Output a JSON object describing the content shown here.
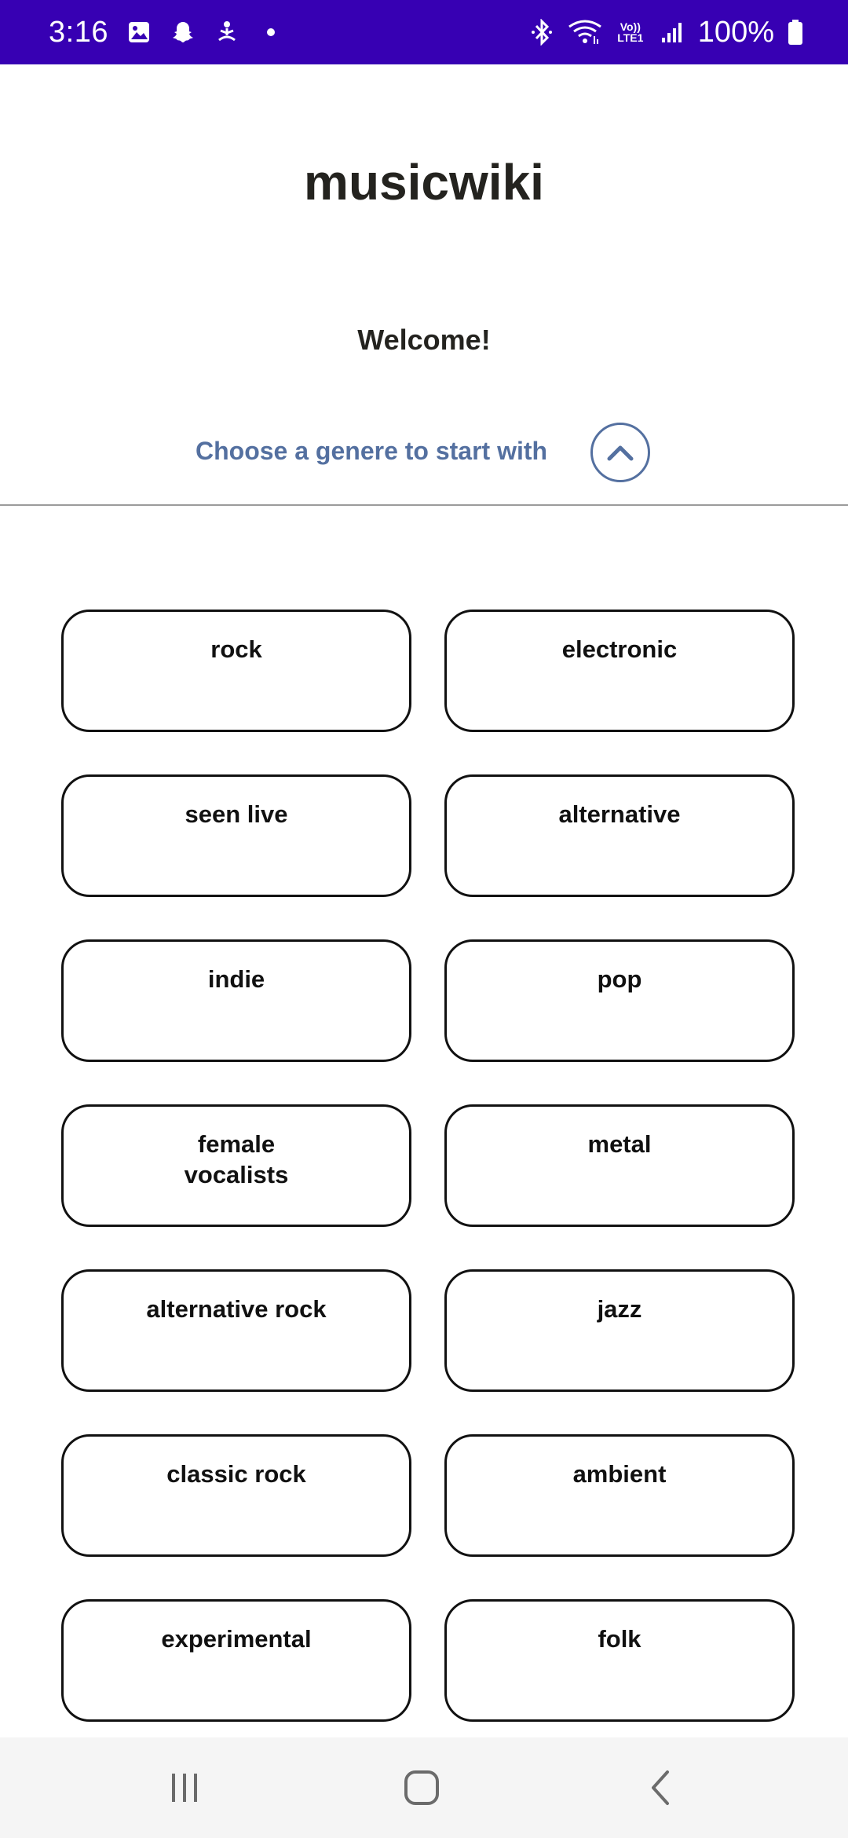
{
  "status_bar": {
    "time": "3:16",
    "battery": "100%",
    "network_label_top": "Vo))",
    "network_label_bottom": "LTE1",
    "icons": [
      "gallery-icon",
      "snapchat-icon",
      "yoga-icon",
      "dot-icon",
      "bluetooth-icon",
      "wifi-icon",
      "signal-icon",
      "battery-icon"
    ]
  },
  "app": {
    "title": "musicwiki",
    "welcome": "Welcome!",
    "choose_prompt": "Choose a genere to start with"
  },
  "genres": [
    "rock",
    "electronic",
    "seen live",
    "alternative",
    "indie",
    "pop",
    "female\nvocalists",
    "metal",
    "alternative rock",
    "jazz",
    "classic rock",
    "ambient",
    "experimental",
    "folk"
  ],
  "colors": {
    "status_bar": "#3700b3",
    "accent": "#5470a0",
    "text": "#24231f"
  }
}
